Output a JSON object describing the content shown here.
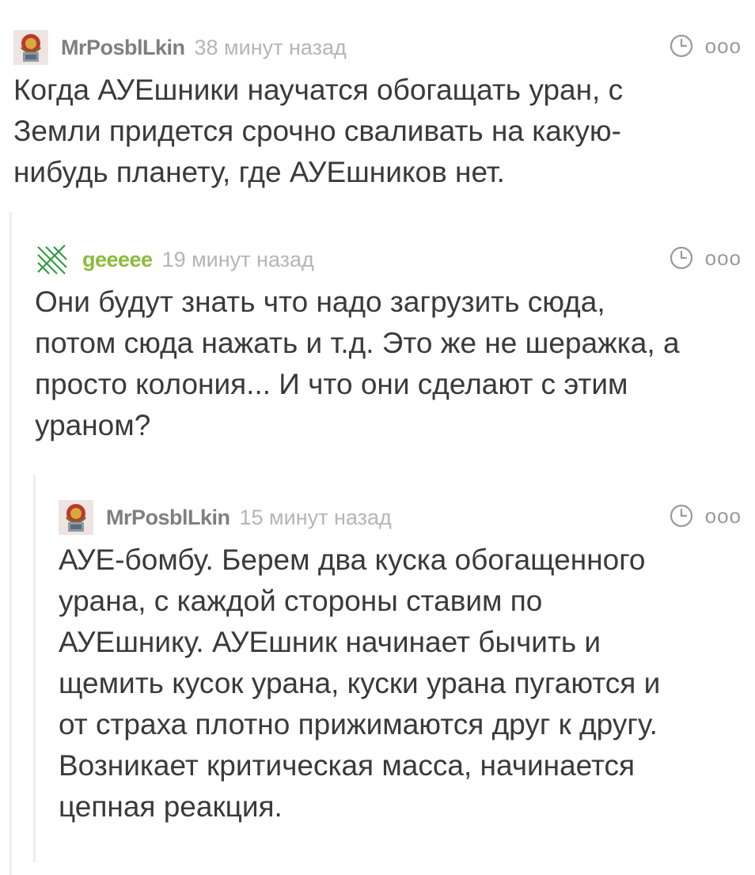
{
  "colors": {
    "text": "#3a3a3a",
    "author": "#7f7f7f",
    "author_alt": "#8bbb3c",
    "time": "#b5b5b5",
    "thread_line": "#eeeeee"
  },
  "comments": [
    {
      "author": "MrPosblLkin",
      "time": "38 минут назад",
      "avatar_icon": "emblem-avatar-icon",
      "text": "Когда АУЕшники научатся обогащать уран, с\nЗемли придется срочно сваливать на какую-\nнибудь планету, где АУЕшников нет."
    },
    {
      "author": "geeeee",
      "time": "19 минут назад",
      "avatar_icon": "green-stripes-avatar-icon",
      "text": "Они будут знать что надо загрузить сюда,\nпотом сюда нажать и т.д. Это же не шеражка, а\nпросто колония... И что они сделают с этим\nураном?"
    },
    {
      "author": "MrPosblLkin",
      "time": "15 минут назад",
      "avatar_icon": "emblem-avatar-icon",
      "text": "АУЕ-бомбу. Берем два куска обогащенного\nурана, с каждой стороны ставим по\nАУЕшнику. АУЕшник начинает бычить и\nщемить кусок урана, куски урана пугаются и\nот страха плотно прижимаются друг к другу.\nВозникает критическая масса, начинается\nцепная реакция."
    }
  ],
  "actions": {
    "clock_icon": "clock-icon",
    "more_label": "ooo"
  }
}
